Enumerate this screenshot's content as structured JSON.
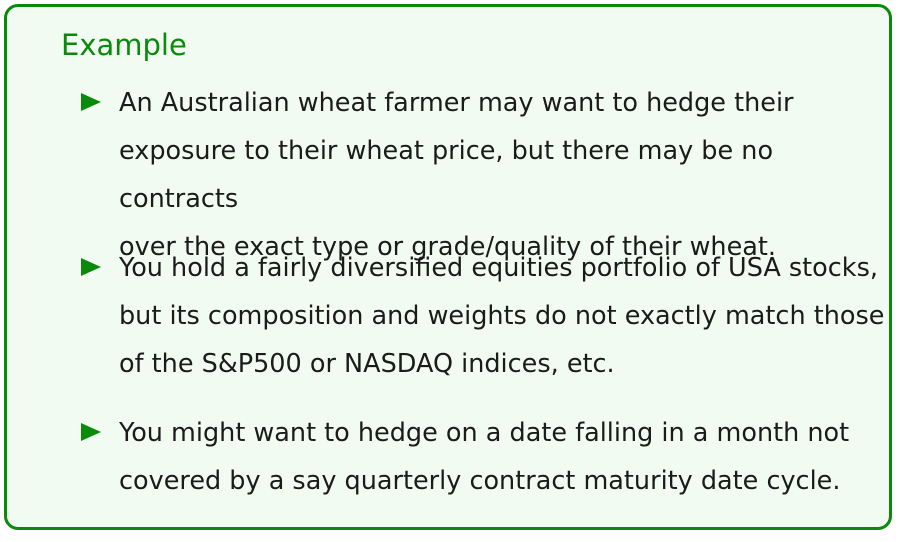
{
  "block": {
    "title": "Example",
    "items": [
      {
        "marker_icon": "triangle-right-icon",
        "text": "An Australian wheat farmer may want to hedge their\nexposure to their wheat price, but there may be no contracts\nover the exact type or grade/quality of their wheat."
      },
      {
        "marker_icon": "triangle-right-icon",
        "text": "You hold a fairly diversified equities portfolio of USA stocks,\nbut its composition and weights do not exactly match those\nof the S&P500 or NASDAQ indices, etc."
      },
      {
        "marker_icon": "triangle-right-icon",
        "text": "You might want to hedge on a date falling in a month not\ncovered by a say quarterly contract maturity date cycle."
      }
    ],
    "colors": {
      "accent": "#0a8a0a",
      "background": "#f2fbf2",
      "text": "#1b1b1b"
    }
  }
}
